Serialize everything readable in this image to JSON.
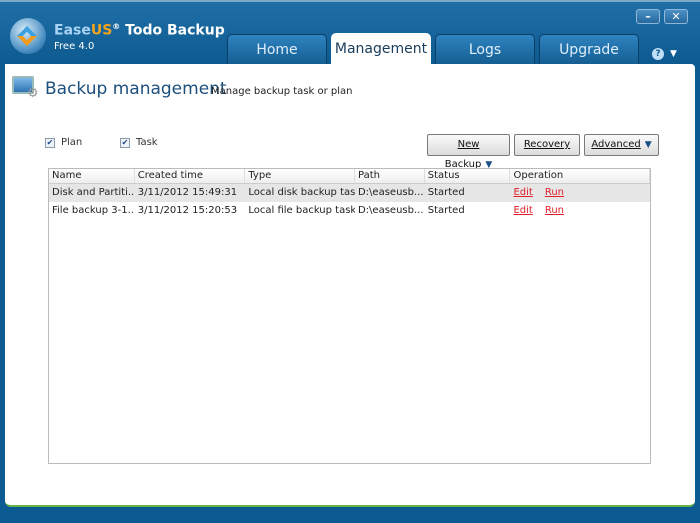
{
  "app": {
    "brand_part1": "Ease",
    "brand_part2": "US",
    "brand_part3": " Todo Backup",
    "trademark": "®",
    "version": "Free 4.0"
  },
  "tabs": [
    {
      "label": "Home"
    },
    {
      "label": "Management"
    },
    {
      "label": "Logs"
    },
    {
      "label": "Upgrade"
    }
  ],
  "window": {
    "minimize": "–",
    "close": "✕",
    "help": "?",
    "menu": "▼"
  },
  "page": {
    "title": "Backup management",
    "subtitle": "Manage backup task or plan"
  },
  "filters": [
    {
      "label": "Plan",
      "checked": true
    },
    {
      "label": "Task",
      "checked": true
    }
  ],
  "toolbar": {
    "new_backup": "New Backup",
    "recovery": "Recovery",
    "advanced": "Advanced",
    "arrow": "▼",
    "check": "✔"
  },
  "table": {
    "columns": [
      "Name",
      "Created time",
      "Type",
      "Path",
      "Status",
      "Operation"
    ],
    "rows": [
      {
        "name": "Disk and Partiti...",
        "created": "3/11/2012 15:49:31",
        "type": "Local disk backup task",
        "path": "D:\\easeusb...",
        "status": "Started",
        "edit": "Edit",
        "run": "Run"
      },
      {
        "name": "File backup 3-1...",
        "created": "3/11/2012 15:20:53",
        "type": "Local file backup task",
        "path": "D:\\easeusb...",
        "status": "Started",
        "edit": "Edit",
        "run": "Run"
      }
    ]
  }
}
